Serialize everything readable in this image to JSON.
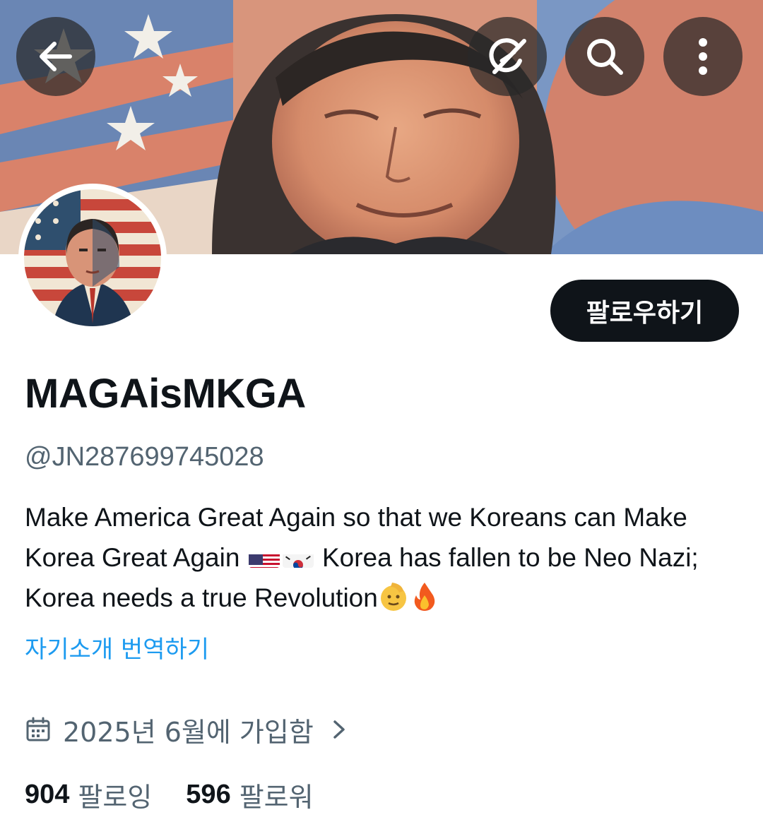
{
  "header": {
    "back_icon": "arrow-left-icon",
    "grok_icon": "grok-icon",
    "search_icon": "search-icon",
    "more_icon": "more-vertical-icon"
  },
  "profile": {
    "display_name": "MAGAisMKGA",
    "handle": "@JN287699745028",
    "follow_label": "팔로우하기",
    "bio": {
      "part1": "Make America Great Again so that we Koreans can Make Korea Great Again ",
      "part2": " Korea has fallen to be Neo Nazi; Korea needs a true Revolution",
      "emojis": [
        "us-flag",
        "kr-flag",
        "saluting-face",
        "fire"
      ]
    },
    "translate_label": "자기소개 번역하기",
    "joined_label": "2025년 6월에 가입함",
    "following": {
      "count": "904",
      "label": "팔로잉"
    },
    "followers": {
      "count": "596",
      "label": "팔로워"
    }
  },
  "colors": {
    "accent": "#1d9bf0",
    "text_primary": "#0f1419",
    "text_secondary": "#536471",
    "button_dark": "#0f1419"
  }
}
